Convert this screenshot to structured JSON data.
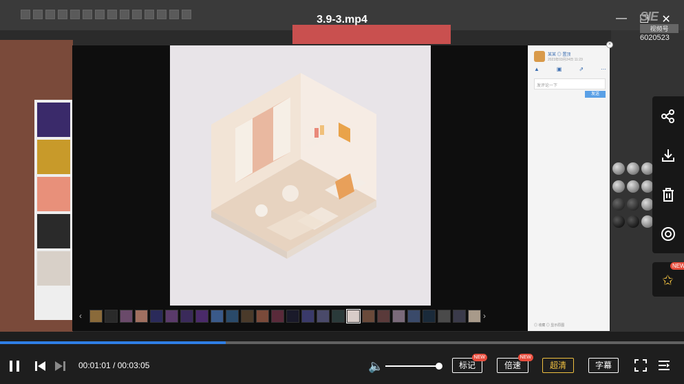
{
  "title": "3.9-3.mp4",
  "brand": {
    "logo_text": "SIE",
    "logo_sub": "视频号",
    "id": "6020523"
  },
  "window": {
    "minimize": "—",
    "maximize": "☐",
    "close": "✕"
  },
  "sidebar": {
    "user_name": "某某 ◎ 置顶",
    "date": "2023年03月24日 11:23",
    "comment_placeholder": "发评论一下",
    "send_label": "发送",
    "footer": "◎ 收藏   ◎ 显示原图"
  },
  "side_close": "×",
  "strip": {
    "prev": "‹",
    "next": "›"
  },
  "progress": {
    "played_fraction": 0.33
  },
  "player": {
    "current_time": "00:01:01",
    "separator": "/",
    "total_time": "00:03:05",
    "mark_label": "标记",
    "speed_label": "倍速",
    "quality_label": "超清",
    "subtitle_label": "字幕",
    "new_badge": "NEW",
    "volume_fraction": 0.95
  },
  "right_actions": {
    "share_icon": "share-icon",
    "download_icon": "download-icon",
    "delete_icon": "trash-icon",
    "record_icon": "record-icon",
    "pin_icon": "pin-icon",
    "pin_badge": "NEW"
  }
}
